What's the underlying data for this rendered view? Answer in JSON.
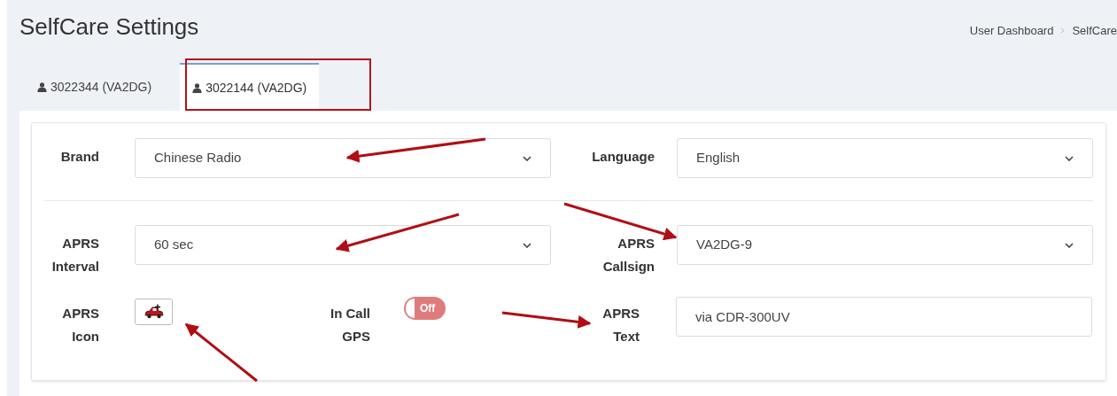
{
  "page_title": "SelfCare Settings",
  "breadcrumb": [
    "User Dashboard",
    "SelfCare"
  ],
  "tabs": [
    {
      "label": "3022344 (VA2DG)",
      "selected": false
    },
    {
      "label": "3022144 (VA2DG)",
      "selected": true
    }
  ],
  "rows": [
    {
      "fields": [
        {
          "kind": "select",
          "label": "Brand",
          "value": "Chinese Radio"
        },
        {
          "kind": "select",
          "label": "Language",
          "value": "English"
        }
      ]
    },
    {
      "fields": [
        {
          "kind": "select",
          "label": "APRS Interval",
          "value": "60 sec"
        },
        {
          "kind": "select",
          "label": "APRS Callsign",
          "value": "VA2DG-9"
        }
      ]
    },
    {
      "fields": [
        {
          "kind": "icon",
          "label": "APRS Icon"
        },
        {
          "kind": "toggle",
          "label": "In Call GPS",
          "on": false,
          "text": "Off"
        },
        {
          "kind": "text",
          "label": "APRS Text",
          "value": "via CDR-300UV"
        }
      ]
    }
  ]
}
